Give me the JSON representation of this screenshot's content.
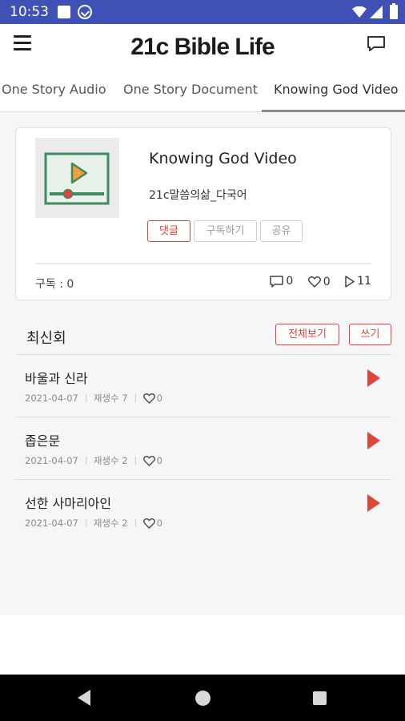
{
  "status_bar": {
    "time": "10:53"
  },
  "header": {
    "title": "21c Bible Life"
  },
  "tabs": [
    {
      "label": "One Story Audio"
    },
    {
      "label": "One Story Document"
    },
    {
      "label": "Knowing God Video",
      "active": true
    }
  ],
  "channel": {
    "title": "Knowing God Video",
    "subtitle": "21c말씀의삶_다국어",
    "chips": {
      "comment": "댓글",
      "subscribe": "구독하기",
      "share": "공유"
    },
    "subscribers": "구독 : 0",
    "comments": "0",
    "likes": "0",
    "plays": "11"
  },
  "section": {
    "title": "최신회",
    "view_all": "전체보기",
    "write": "쓰기"
  },
  "episodes": [
    {
      "title": "바울과 신라",
      "date": "2021-04-07",
      "plays": "재생수 7",
      "likes": "0"
    },
    {
      "title": "좁은문",
      "date": "2021-04-07",
      "plays": "재생수 2",
      "likes": "0"
    },
    {
      "title": "선한 사마리아인",
      "date": "2021-04-07",
      "plays": "재생수 2",
      "likes": "0"
    }
  ],
  "colors": {
    "accent": "#e0453a",
    "status_bar": "#3f51b5",
    "thumb_green": "#3f8a5f"
  }
}
